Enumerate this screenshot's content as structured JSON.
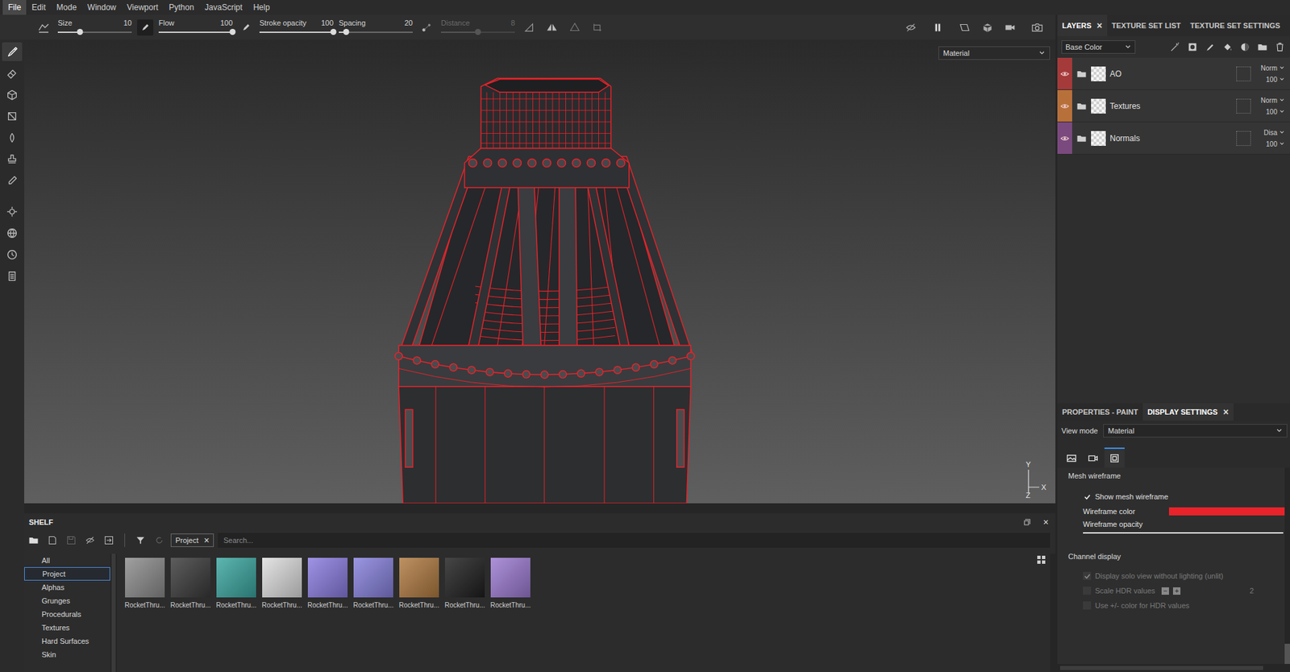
{
  "menu": [
    {
      "label": "File",
      "selected": true
    },
    {
      "label": "Edit",
      "selected": false
    },
    {
      "label": "Mode",
      "selected": false
    },
    {
      "label": "Window",
      "selected": false
    },
    {
      "label": "Viewport",
      "selected": false
    },
    {
      "label": "Python",
      "selected": false
    },
    {
      "label": "JavaScript",
      "selected": false
    },
    {
      "label": "Help",
      "selected": false
    }
  ],
  "tools": [
    {
      "kind": "paint",
      "selected": true
    },
    {
      "kind": "erase",
      "selected": false
    },
    {
      "kind": "project",
      "selected": false
    },
    {
      "kind": "polyfill",
      "selected": false
    },
    {
      "kind": "smudge",
      "selected": false
    },
    {
      "kind": "clone",
      "selected": false
    },
    {
      "kind": "picker",
      "selected": false
    },
    {
      "kind": "settings",
      "selected": false
    },
    {
      "kind": "globe",
      "selected": false
    },
    {
      "kind": "history",
      "selected": false
    },
    {
      "kind": "log",
      "selected": false
    }
  ],
  "toolbar": {
    "items": [
      {
        "kind": "slider",
        "label": "Size",
        "value": "10",
        "level": 0.3,
        "disabled": false
      },
      {
        "kind": "toggle",
        "on": true
      },
      {
        "kind": "slider",
        "label": "Flow",
        "value": "100",
        "level": 1,
        "disabled": false
      },
      {
        "kind": "toggle",
        "on": false
      },
      {
        "kind": "slider",
        "label": "Stroke opacity",
        "value": "100",
        "level": 1,
        "disabled": false
      },
      {
        "kind": "slider",
        "label": "Spacing",
        "value": "20",
        "level": 0.1,
        "disabled": false
      },
      {
        "kind": "lazy"
      },
      {
        "kind": "slider",
        "label": "Distance",
        "value": "8",
        "level": 0.5,
        "disabled": true
      }
    ]
  },
  "viewport": {
    "view": "Material",
    "axes": {
      "y": "Y",
      "x": "X",
      "z": "Z"
    }
  },
  "panel": {
    "tabs": [
      {
        "label": "LAYERS",
        "selected": true,
        "close": "×"
      },
      {
        "label": "TEXTURE SET LIST",
        "selected": false,
        "close": ""
      },
      {
        "label": "TEXTURE SET SETTINGS",
        "selected": false,
        "close": ""
      }
    ],
    "channel": "Base Color",
    "layers": [
      {
        "name": "AO",
        "visible": true,
        "color": "#a53a3a",
        "blend": "Norm",
        "opacity": "100"
      },
      {
        "name": "Textures",
        "visible": true,
        "color": "#b8703a",
        "blend": "Norm",
        "opacity": "100"
      },
      {
        "name": "Normals",
        "visible": true,
        "color": "#7a4a7e",
        "blend": "Disa",
        "opacity": "100"
      }
    ]
  },
  "properties": {
    "tabs": [
      {
        "label": "PROPERTIES - PAINT",
        "selected": false,
        "close": ""
      },
      {
        "label": "DISPLAY SETTINGS",
        "selected": true,
        "close": "×"
      }
    ],
    "view_mode_label": "View mode",
    "view_mode": "Material",
    "section_tabs": [
      {
        "kind": "environment",
        "selected": false
      },
      {
        "kind": "camera",
        "selected": false
      },
      {
        "kind": "display",
        "selected": true
      }
    ],
    "mesh_wireframe": {
      "title": "Mesh wireframe",
      "show_label": "Show mesh wireframe",
      "show": true,
      "color_label": "Wireframe color",
      "color": "#e8232a",
      "opacity_label": "Wireframe opacity",
      "opacity_level": 1
    },
    "channel_display": {
      "title": "Channel display",
      "options": [
        {
          "label": "Display solo view without lighting (unlit)",
          "checked": true,
          "disabled": true,
          "value": ""
        },
        {
          "label": "Scale HDR values",
          "checked": false,
          "disabled": true,
          "value": "2"
        },
        {
          "label": "Use +/- color for HDR values",
          "checked": false,
          "disabled": true,
          "value": ""
        }
      ],
      "minus": "−",
      "plus": "+"
    }
  },
  "shelf": {
    "title": "SHELF",
    "close": "×",
    "filter_tab": {
      "label": "Project",
      "close": "×"
    },
    "search_placeholder": "Search...",
    "categories": [
      {
        "label": "All",
        "selected": false
      },
      {
        "label": "Project",
        "selected": true
      },
      {
        "label": "Alphas",
        "selected": false
      },
      {
        "label": "Grunges",
        "selected": false
      },
      {
        "label": "Procedurals",
        "selected": false
      },
      {
        "label": "Textures",
        "selected": false
      },
      {
        "label": "Hard Surfaces",
        "selected": false
      },
      {
        "label": "Skin",
        "selected": false
      }
    ],
    "items": [
      {
        "label": "RocketThru...",
        "color": "#8c8c8c"
      },
      {
        "label": "RocketThru...",
        "color": "#3a3a3a"
      },
      {
        "label": "RocketThru...",
        "color": "#3aa6a0"
      },
      {
        "label": "RocketThru...",
        "color": "#dedede"
      },
      {
        "label": "RocketThru...",
        "color": "#8a7ce0"
      },
      {
        "label": "RocketThru...",
        "color": "#8680dc"
      },
      {
        "label": "RocketThru...",
        "color": "#b07a40"
      },
      {
        "label": "RocketThru...",
        "color": "#1e1e1e"
      },
      {
        "label": "RocketThru...",
        "color": "#9c7ad2"
      }
    ]
  }
}
